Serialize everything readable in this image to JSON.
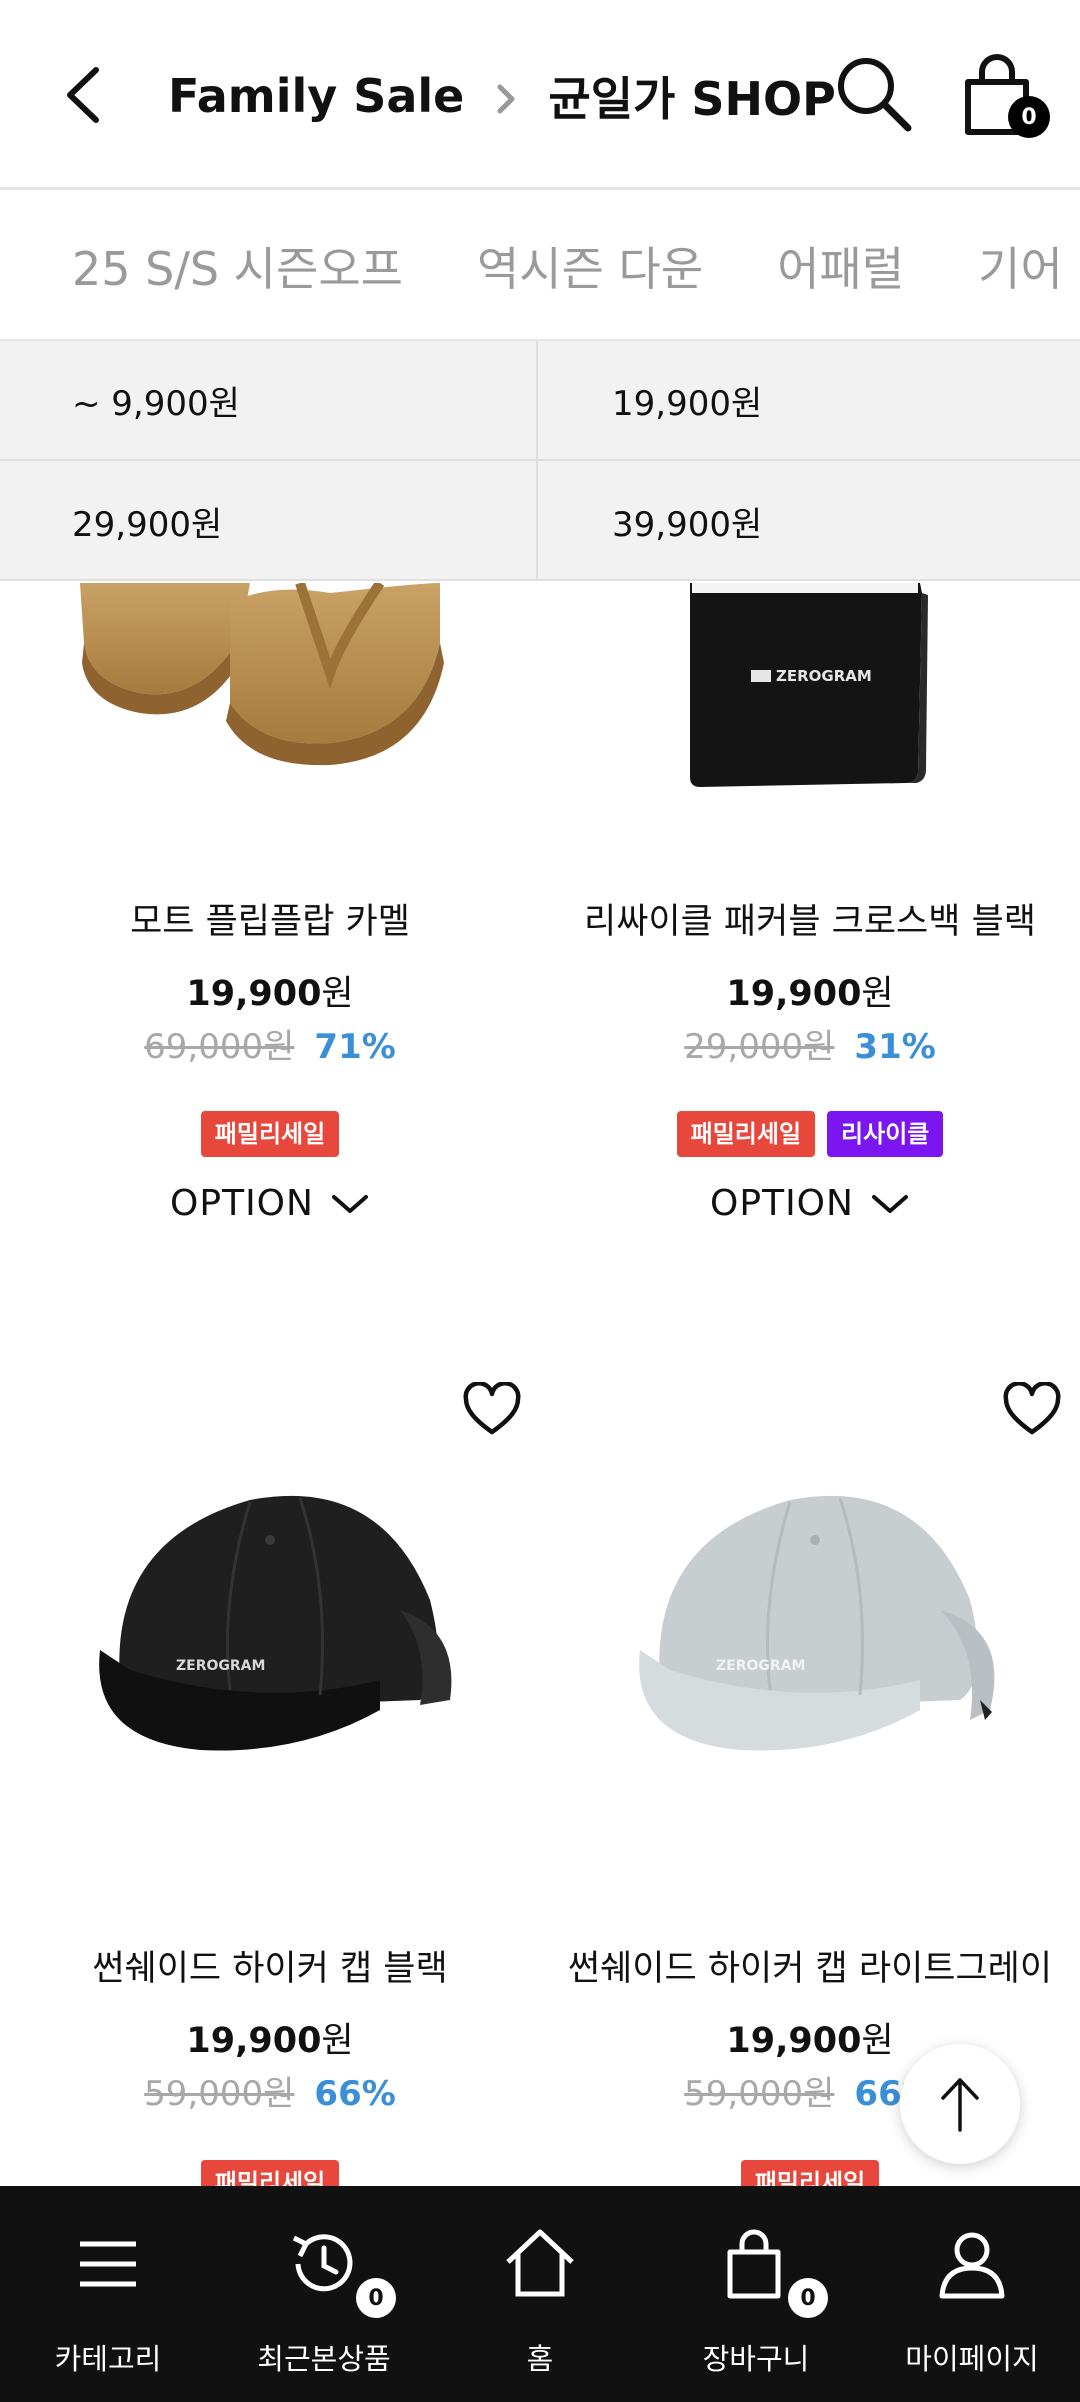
{
  "header": {
    "title_parent": "Family Sale",
    "title_current": "균일가 SHOP",
    "cart_count": "0"
  },
  "tabs": [
    "25 S/S 시즌오프",
    "역시즌 다운",
    "어패럴",
    "기어"
  ],
  "price_filters": [
    "~ 9,900원",
    "19,900원",
    "29,900원",
    "39,900원"
  ],
  "products": [
    {
      "name": "모트 플립플랍 카멜",
      "price": "19,900",
      "currency": "원",
      "original": "69,000원",
      "discount": "71%",
      "tags": [
        {
          "label": "패밀리세일",
          "color": "#e8473c"
        }
      ],
      "option_label": "OPTION",
      "icon": "flip-flop-sandal"
    },
    {
      "name": "리싸이클 패커블 크로스백 블랙",
      "price": "19,900",
      "currency": "원",
      "original": "29,000원",
      "discount": "31%",
      "tags": [
        {
          "label": "패밀리세일",
          "color": "#e8473c"
        },
        {
          "label": "리사이클",
          "color": "#7b16f0"
        }
      ],
      "option_label": "OPTION",
      "icon": "crossbag",
      "logo_text": "ZEROGRAM"
    },
    {
      "name": "썬쉐이드 하이커 캡 블랙",
      "price": "19,900",
      "currency": "원",
      "original": "59,000원",
      "discount": "66%",
      "tags": [
        {
          "label": "패밀리세일",
          "color": "#e8473c"
        }
      ],
      "icon": "cap-black",
      "logo_text": "ZEROGRAM"
    },
    {
      "name": "썬쉐이드 하이커 캡 라이트그레이",
      "price": "19,900",
      "currency": "원",
      "original": "59,000원",
      "discount": "66%",
      "tags": [
        {
          "label": "패밀리세일",
          "color": "#e8473c"
        }
      ],
      "icon": "cap-lightgray",
      "logo_text": "ZEROGRAM"
    }
  ],
  "bottom_nav": [
    {
      "label": "카테고리",
      "icon": "menu-icon"
    },
    {
      "label": "최근본상품",
      "icon": "history-icon",
      "badge": "0"
    },
    {
      "label": "홈",
      "icon": "home-icon"
    },
    {
      "label": "장바구니",
      "icon": "bag-icon",
      "badge": "0"
    },
    {
      "label": "마이페이지",
      "icon": "user-icon"
    }
  ],
  "colors": {
    "accent_discount": "#3a8fd6",
    "tag_red": "#e8473c",
    "tag_purple": "#7b16f0",
    "nav_background": "#111111"
  }
}
